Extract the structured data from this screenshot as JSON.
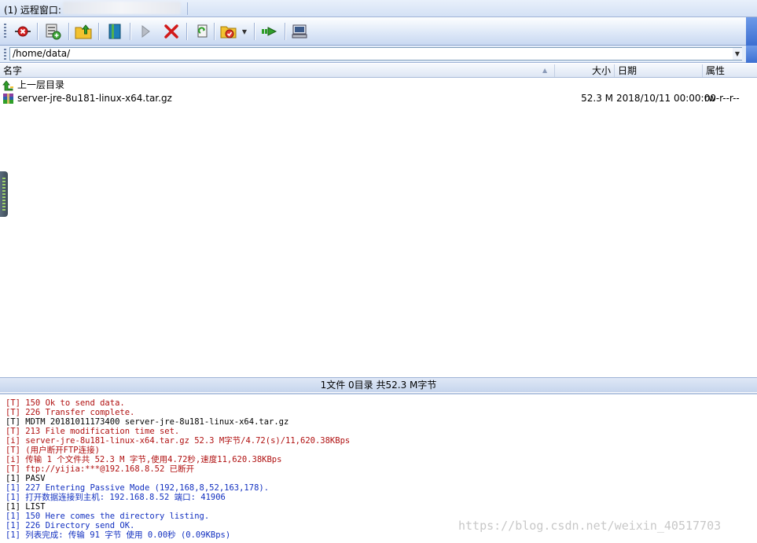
{
  "window": {
    "title": "(1) 远程窗口:"
  },
  "toolbar": {
    "buttons": [
      {
        "icon": "disconnect-icon"
      },
      {
        "icon": "site-manager-icon"
      },
      {
        "icon": "parent-folder-icon"
      },
      {
        "icon": "bookmark-icon"
      },
      {
        "icon": "play-icon"
      },
      {
        "icon": "stop-icon"
      },
      {
        "icon": "refresh-icon"
      },
      {
        "icon": "folder-options-icon"
      },
      {
        "icon": "transfer-icon"
      },
      {
        "icon": "terminal-icon"
      }
    ]
  },
  "address": {
    "path": "/home/data/"
  },
  "columns": {
    "name": "名字",
    "size": "大小",
    "date": "日期",
    "attr": "属性"
  },
  "files": [
    {
      "name": "上一层目录",
      "icon": "parent-dir-icon",
      "size": "",
      "date": "",
      "attr": ""
    },
    {
      "name": "server-jre-8u181-linux-x64.tar.gz",
      "icon": "archive-icon",
      "size": "52.3 M",
      "date": "2018/10/11 00:00:00",
      "attr": "rw-r--r--"
    }
  ],
  "status": {
    "text": "1文件 0目录 共52.3 M字节"
  },
  "log": [
    {
      "text": "[T] 150 Ok to send data.",
      "color": "red"
    },
    {
      "text": "[T] 226 Transfer complete.",
      "color": "red"
    },
    {
      "text": "[T] MDTM 20181011173400 server-jre-8u181-linux-x64.tar.gz",
      "color": "black"
    },
    {
      "text": "[T] 213 File modification time set.",
      "color": "red"
    },
    {
      "text": "[i] server-jre-8u181-linux-x64.tar.gz 52.3 M字节/4.72(s)/11,620.38KBps",
      "color": "red"
    },
    {
      "text": "[T] (用户断开FTP连接)",
      "color": "red"
    },
    {
      "text": "[i] 传输 1 个文件共 52.3 M 字节,使用4.72秒,速度11,620.38KBps",
      "color": "red"
    },
    {
      "text": "[T] ftp://yijia:***@192.168.8.52 已断开",
      "color": "red"
    },
    {
      "text": "[1] PASV",
      "color": "black"
    },
    {
      "text": "[1] 227 Entering Passive Mode (192,168,8,52,163,178).",
      "color": "blue"
    },
    {
      "text": "[1] 打开数据连接到主机: 192.168.8.52 端口: 41906",
      "color": "blue"
    },
    {
      "text": "[1] LIST",
      "color": "black"
    },
    {
      "text": "[1] 150 Here comes the directory listing.",
      "color": "blue"
    },
    {
      "text": "[1] 226 Directory send OK.",
      "color": "blue"
    },
    {
      "text": "[1] 列表完成: 传输 91 字节 使用 0.00秒 (0.09KBps)",
      "color": "blue"
    }
  ],
  "watermark": "https://blog.csdn.net/weixin_40517703"
}
